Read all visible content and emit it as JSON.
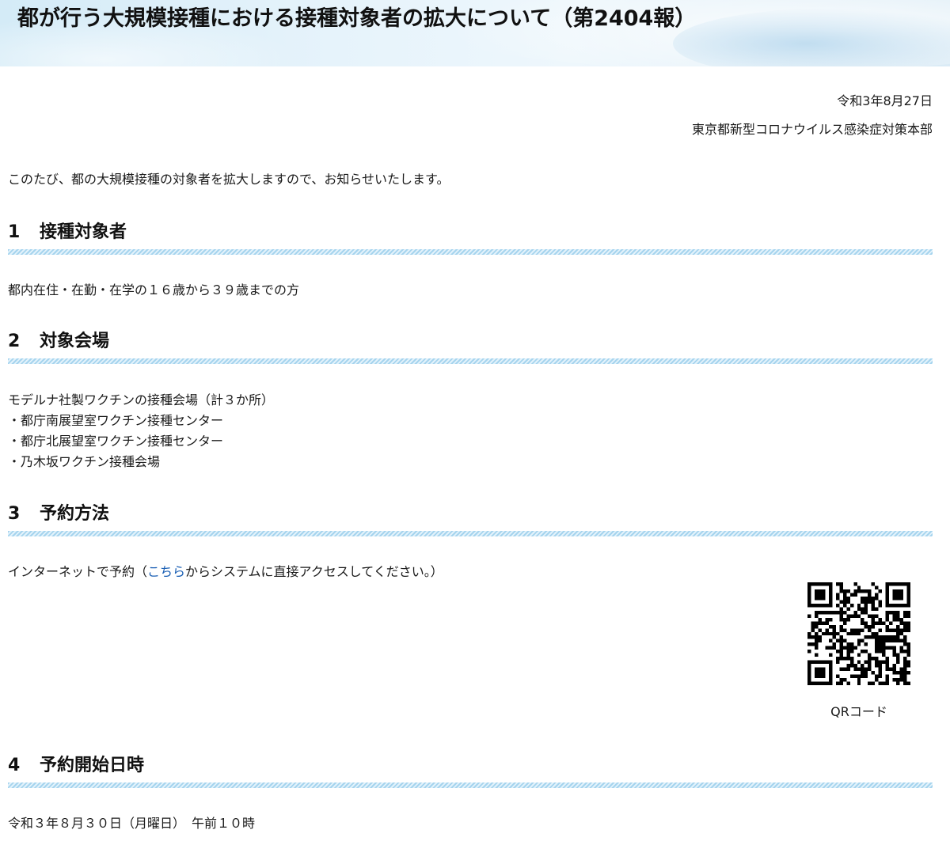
{
  "header": {
    "title": "都が行う大規模接種における接種対象者の拡大について（第2404報）"
  },
  "meta": {
    "date": "令和3年8月27日",
    "issuer": "東京都新型コロナウイルス感染症対策本部"
  },
  "intro": "このたび、都の大規模接種の対象者を拡大しますので、お知らせいたします。",
  "sections": [
    {
      "number": "1",
      "heading": "接種対象者",
      "body": "都内在住・在勤・在学の１６歳から３９歳までの方"
    },
    {
      "number": "2",
      "heading": "対象会場",
      "body": "モデルナ社製ワクチンの接種会場（計３か所）",
      "items": [
        "・都庁南展望室ワクチン接種センター",
        "・都庁北展望室ワクチン接種センター",
        "・乃木坂ワクチン接種会場"
      ]
    },
    {
      "number": "3",
      "heading": "予約方法",
      "body_before": "インターネットで予約（",
      "link_text": "こちら",
      "body_after": "からシステムに直接アクセスしてください。）",
      "qr_caption": "QRコード"
    },
    {
      "number": "4",
      "heading": "予約開始日時",
      "body": "令和３年８月３０日（月曜日）　午前１０時"
    }
  ],
  "colors": {
    "link": "#1a5fb4",
    "heading_rule": "#a6d4ee",
    "banner": "#d4ebf7"
  },
  "icons": [
    "qr-code-image"
  ]
}
